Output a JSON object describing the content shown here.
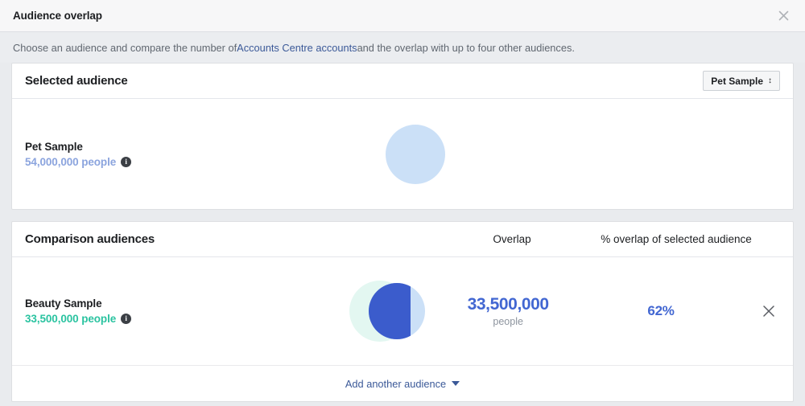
{
  "dialog": {
    "title": "Audience overlap",
    "close_icon": "close-icon",
    "description_prefix": "Choose an audience and compare the number of ",
    "description_link": "Accounts Centre accounts",
    "description_suffix": " and the overlap with up to four other audiences."
  },
  "selected_card": {
    "title": "Selected audience",
    "dropdown": {
      "value": "Pet Sample",
      "caret": "↕"
    },
    "audience": {
      "name": "Pet Sample",
      "count": "54,000,000 people",
      "info_icon": "i",
      "circle_color": "#cbe0f7"
    }
  },
  "comparison_card": {
    "title": "Comparison audiences",
    "columns": {
      "overlap": "Overlap",
      "percent": "% overlap of selected audience"
    },
    "rows": [
      {
        "name": "Beauty Sample",
        "count": "33,500,000 people",
        "info_icon": "i",
        "overlap_value": "33,500,000",
        "overlap_unit": "people",
        "percent": "62%",
        "remove_icon": "close-icon",
        "venn_left_color": "#e3f7f1",
        "venn_right_color": "#cbe0f7",
        "venn_intersection_color": "#3b5ccc"
      }
    ],
    "footer": {
      "add_label": "Add another audience",
      "caret_icon": "chevron-down-icon"
    }
  },
  "colors": {
    "accent_blue": "#4267d2",
    "link_blue": "#3b5998",
    "teal": "#2ac3a0",
    "periwinkle": "#8ba4de",
    "page_background": "#e9ebee"
  }
}
